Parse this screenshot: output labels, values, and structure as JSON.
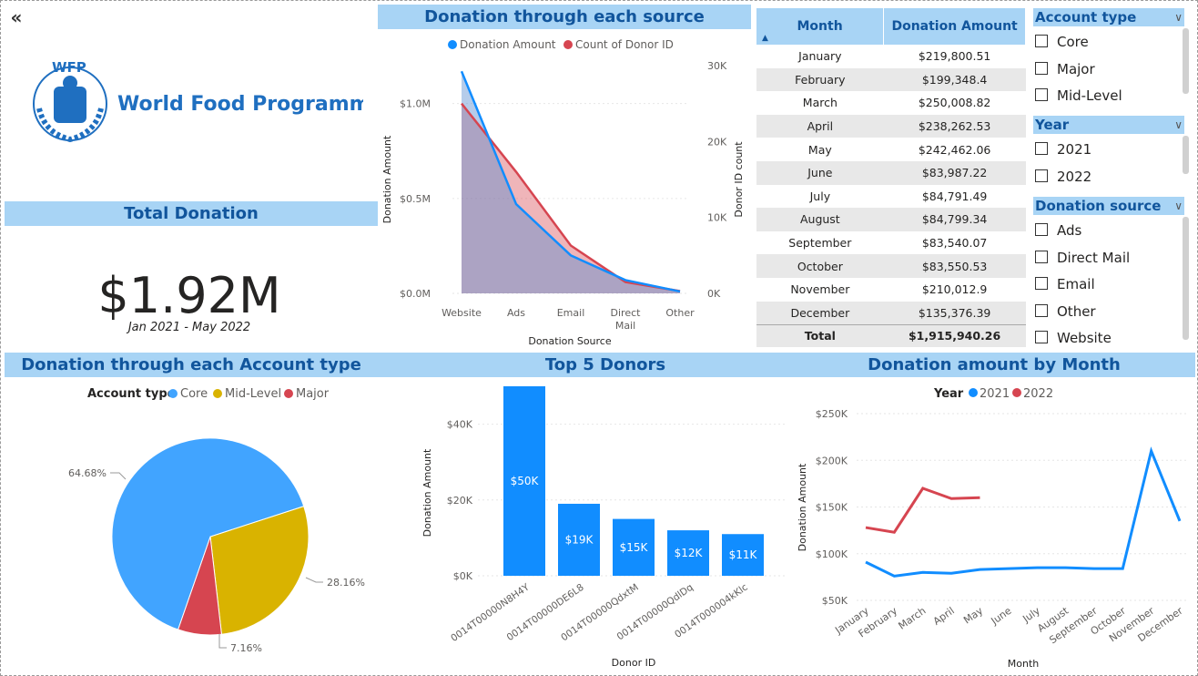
{
  "header_titles": {
    "source": "Donation through each source",
    "total": "Total Donation",
    "account": "Donation through each Account type",
    "top5": "Top 5 Donors",
    "month": "Donation amount by Month"
  },
  "logo": {
    "abbr": "WFP",
    "name": "World Food Programme"
  },
  "kpi": {
    "value": "$1.92M",
    "subtitle": "Jan 2021 - May 2022"
  },
  "colors": {
    "blue": "#118dff",
    "red": "#d64550",
    "gold": "#d9b300",
    "lightblue": "#41a4ff",
    "header_bg": "#a8d4f5",
    "header_text": "#11559c"
  },
  "table": {
    "col_month": "Month",
    "col_amount": "Donation Amount",
    "rows": [
      {
        "month": "January",
        "amount": "$219,800.51"
      },
      {
        "month": "February",
        "amount": "$199,348.4"
      },
      {
        "month": "March",
        "amount": "$250,008.82"
      },
      {
        "month": "April",
        "amount": "$238,262.53"
      },
      {
        "month": "May",
        "amount": "$242,462.06"
      },
      {
        "month": "June",
        "amount": "$83,987.22"
      },
      {
        "month": "July",
        "amount": "$84,791.49"
      },
      {
        "month": "August",
        "amount": "$84,799.34"
      },
      {
        "month": "September",
        "amount": "$83,540.07"
      },
      {
        "month": "October",
        "amount": "$83,550.53"
      },
      {
        "month": "November",
        "amount": "$210,012.9"
      },
      {
        "month": "December",
        "amount": "$135,376.39"
      }
    ],
    "total_label": "Total",
    "total_value": "$1,915,940.26"
  },
  "slicers": {
    "account": {
      "title": "Account type",
      "options": [
        "Core",
        "Major",
        "Mid-Level"
      ]
    },
    "year": {
      "title": "Year",
      "options": [
        "2021",
        "2022"
      ]
    },
    "source": {
      "title": "Donation source",
      "options": [
        "Ads",
        "Direct Mail",
        "Email",
        "Other",
        "Website"
      ]
    }
  },
  "chart_data": [
    {
      "id": "source",
      "type": "area",
      "categories": [
        "Website",
        "Ads",
        "Email",
        "Direct Mail",
        "Other"
      ],
      "series": [
        {
          "name": "Donation Amount",
          "values": [
            1170000,
            470000,
            200000,
            70000,
            10000
          ],
          "axis": "left"
        },
        {
          "name": "Count of Donor ID",
          "values": [
            25000,
            16000,
            6300,
            1500,
            300
          ],
          "axis": "right"
        }
      ],
      "legend": [
        "Donation Amount",
        "Count of Donor ID"
      ],
      "xlabel": "Donation Source",
      "ylabel": "Donation Amount",
      "y2label": "Donor ID count",
      "yticks": [
        "$0.0M",
        "$0.5M",
        "$1.0M"
      ],
      "y2ticks": [
        "0K",
        "10K",
        "20K",
        "30K"
      ],
      "ylim": [
        0,
        1200000
      ],
      "y2lim": [
        0,
        30000
      ]
    },
    {
      "id": "account",
      "type": "pie",
      "legend_title": "Account type",
      "labels": [
        "Core",
        "Mid-Level",
        "Major"
      ],
      "values": [
        64.68,
        28.16,
        7.16
      ],
      "value_labels": [
        "64.68%",
        "28.16%",
        "7.16%"
      ]
    },
    {
      "id": "top5",
      "type": "bar",
      "categories": [
        "0014T00000N8H4Y",
        "0014T00000DE6L8",
        "0014T00000QdxtM",
        "0014T00000QdlDq",
        "0014T000004kKlc"
      ],
      "values": [
        50000,
        19000,
        15000,
        12000,
        11000
      ],
      "value_labels": [
        "$50K",
        "$19K",
        "$15K",
        "$12K",
        "$11K"
      ],
      "xlabel": "Donor ID",
      "ylabel": "Donation Amount",
      "yticks": [
        "$0K",
        "$20K",
        "$40K"
      ],
      "ylim": [
        0,
        50000
      ]
    },
    {
      "id": "month",
      "type": "line",
      "legend_title": "Year",
      "categories": [
        "January",
        "February",
        "March",
        "April",
        "May",
        "June",
        "July",
        "August",
        "September",
        "October",
        "November",
        "December"
      ],
      "series": [
        {
          "name": "2021",
          "values": [
            91000,
            76000,
            80000,
            79000,
            83000,
            84000,
            85000,
            85000,
            84000,
            84000,
            210000,
            135000
          ]
        },
        {
          "name": "2022",
          "values": [
            128000,
            123000,
            170000,
            159000,
            160000
          ]
        }
      ],
      "xlabel": "Month",
      "ylabel": "Donation Amount",
      "yticks": [
        "$50K",
        "$100K",
        "$150K",
        "$200K",
        "$250K"
      ],
      "ylim": [
        50000,
        250000
      ]
    }
  ]
}
